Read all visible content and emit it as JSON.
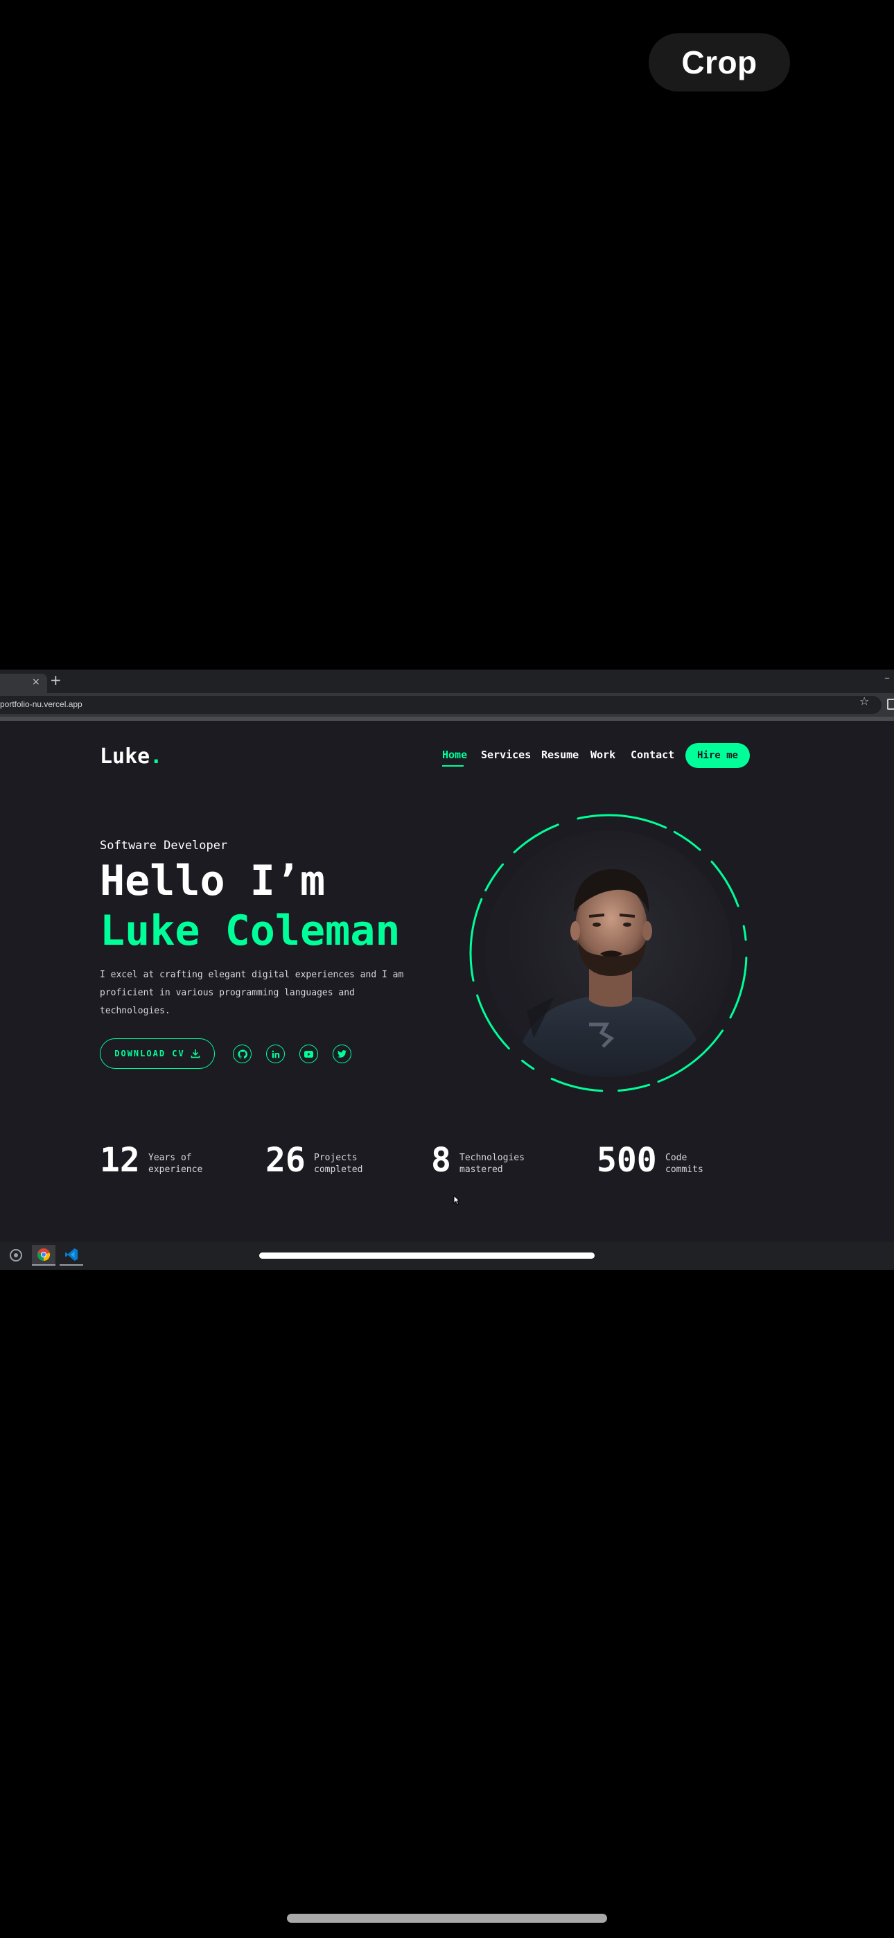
{
  "overlay": {
    "crop_label": "Crop"
  },
  "browser": {
    "tab_close": "×",
    "new_tab": "+",
    "url": "portfolio-nu.vercel.app"
  },
  "site": {
    "logo": "Luke",
    "logo_dot": ".",
    "nav": {
      "home": "Home",
      "services": "Services",
      "resume": "Resume",
      "work": "Work",
      "contact": "Contact",
      "hire": "Hire me"
    },
    "hero": {
      "role": "Software Developer",
      "hello": "Hello I’m",
      "name": "Luke Coleman",
      "description": "I excel at crafting elegant digital experiences and I am proficient in various programming languages and technologies.",
      "cv_label": "DOWNLOAD CV"
    },
    "socials": [
      "github-icon",
      "linkedin-icon",
      "youtube-icon",
      "twitter-icon"
    ],
    "stats": [
      {
        "num": "12",
        "label": "Years of\nexperience"
      },
      {
        "num": "26",
        "label": "Projects\ncompleted"
      },
      {
        "num": "8",
        "label": "Technologies\nmastered"
      },
      {
        "num": "500",
        "label": "Code\ncommits"
      }
    ]
  },
  "colors": {
    "accent": "#00ff99",
    "background": "#1c1b22"
  }
}
